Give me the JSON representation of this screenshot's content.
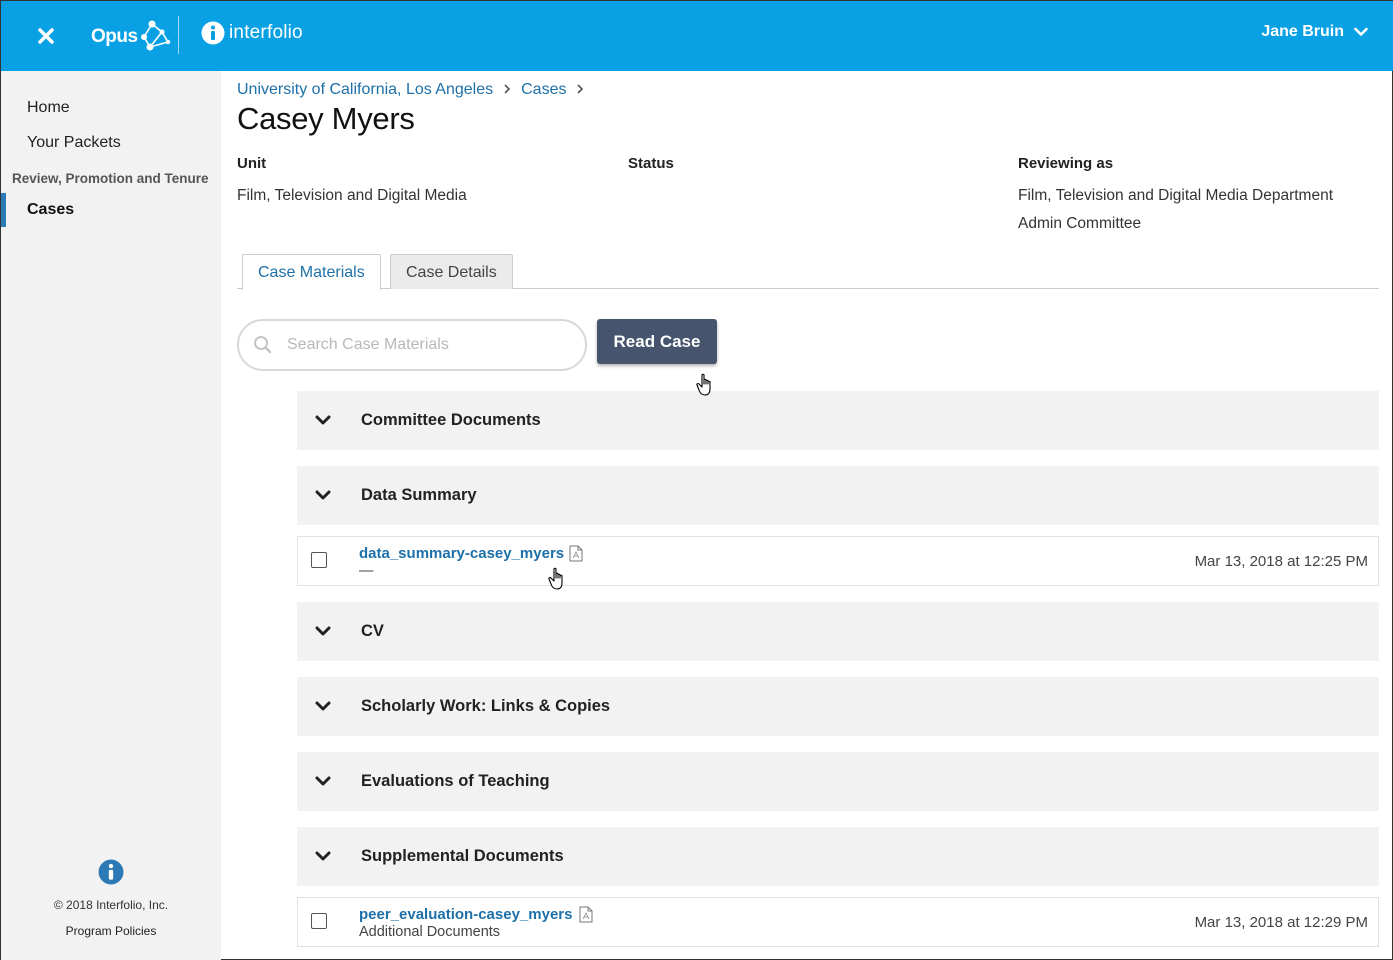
{
  "header": {
    "brand": "Opus",
    "partner": "interfolio",
    "user_name": "Jane Bruin"
  },
  "sidebar": {
    "items": [
      {
        "label": "Home"
      },
      {
        "label": "Your Packets"
      }
    ],
    "section_label": "Review, Promotion and Tenure",
    "active_item": "Cases",
    "footer": {
      "copyright": "© 2018 Interfolio, Inc.",
      "policies": "Program Policies"
    }
  },
  "breadcrumb": {
    "items": [
      "University of California, Los Angeles",
      "Cases"
    ]
  },
  "page": {
    "title": "Casey Myers",
    "unit_label": "Unit",
    "unit_value": "Film, Television and Digital Media",
    "status_label": "Status",
    "status_value": "",
    "reviewing_label": "Reviewing as",
    "reviewing_value_1": "Film, Television and Digital Media Department",
    "reviewing_value_2": "Admin Committee"
  },
  "tabs": [
    {
      "label": "Case Materials",
      "active": true
    },
    {
      "label": "Case Details",
      "active": false
    }
  ],
  "search": {
    "placeholder": "Search Case Materials",
    "value": ""
  },
  "read_case_label": "Read Case",
  "sections": [
    {
      "title": "Committee Documents"
    },
    {
      "title": "Data Summary"
    },
    {
      "title": "CV"
    },
    {
      "title": "Scholarly Work: Links & Copies"
    },
    {
      "title": "Evaluations of Teaching"
    },
    {
      "title": "Supplemental Documents"
    }
  ],
  "documents": [
    {
      "name": "data_summary-casey_myers",
      "subtitle": "—",
      "date": "Mar 13, 2018 at 12:25 PM"
    },
    {
      "name": "peer_evaluation-casey_myers",
      "subtitle": "Additional Documents",
      "date": "Mar 13, 2018 at 12:29 PM"
    }
  ],
  "colors": {
    "topbar": "#0aa1e4",
    "link": "#1e70a8",
    "button": "#46546e",
    "sidebar_active": "#2c7ab5"
  }
}
